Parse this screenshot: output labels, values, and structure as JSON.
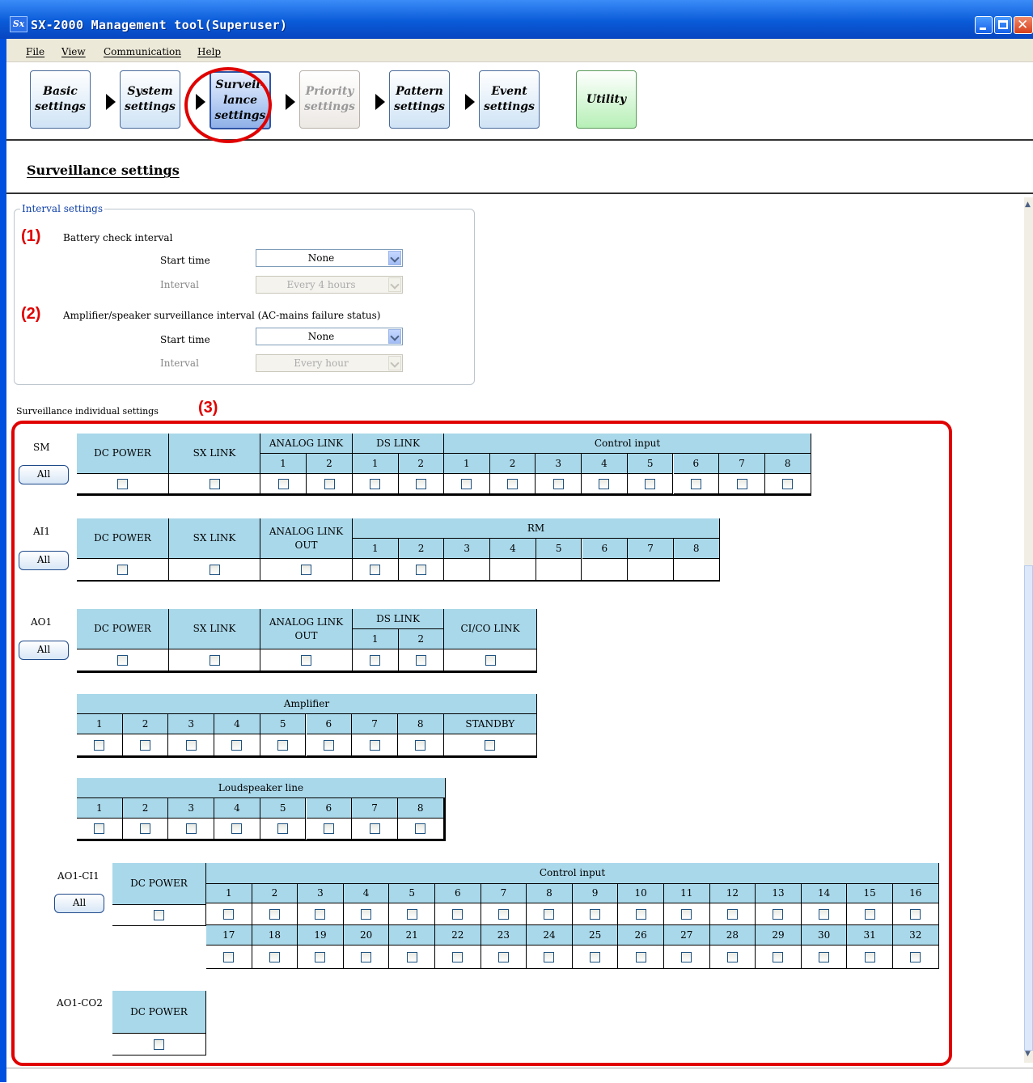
{
  "window": {
    "title": "SX-2000 Management tool(Superuser)",
    "app_icon": "Sx"
  },
  "menu": [
    "File",
    "View",
    "Communication",
    "Help"
  ],
  "nav": {
    "steps": [
      {
        "label": [
          "Basic",
          "settings"
        ],
        "state": "normal"
      },
      {
        "label": [
          "System",
          "settings"
        ],
        "state": "normal"
      },
      {
        "label": [
          "Surveil-",
          "lance",
          "settings"
        ],
        "state": "active"
      },
      {
        "label": [
          "Priority",
          "settings"
        ],
        "state": "disabled"
      },
      {
        "label": [
          "Pattern",
          "settings"
        ],
        "state": "normal"
      },
      {
        "label": [
          "Event",
          "settings"
        ],
        "state": "normal"
      },
      {
        "label": [
          "Utility"
        ],
        "state": "utility"
      }
    ]
  },
  "page": {
    "title": "Surveillance settings"
  },
  "interval": {
    "legend": "Interval settings",
    "battery": {
      "marker": "(1)",
      "title": "Battery check interval",
      "start_label": "Start time",
      "start_value": "None",
      "interval_label": "Interval",
      "interval_value": "Every 4 hours"
    },
    "amp": {
      "marker": "(2)",
      "title": "Amplifier/speaker surveillance interval (AC-mains failure status)",
      "start_label": "Start time",
      "start_value": "None",
      "interval_label": "Interval",
      "interval_value": "Every hour"
    }
  },
  "individual": {
    "title": "Surveillance individual settings",
    "marker": "(3)",
    "all_label": "All",
    "modules": {
      "sm": "SM",
      "ai1": "AI1",
      "ao1": "AO1",
      "ao1_ci1": "AO1-CI1",
      "ao1_co2": "AO1-CO2"
    },
    "headers": {
      "dc_power": "DC POWER",
      "sx_link": "SX LINK",
      "analog_link": "ANALOG LINK",
      "analog_link_out": [
        "ANALOG LINK",
        "OUT"
      ],
      "ds_link": "DS LINK",
      "control_input": "Control input",
      "rm": "RM",
      "cico_link": "CI/CO LINK",
      "amplifier": "Amplifier",
      "standby": "STANDBY",
      "loudspeaker_line": "Loudspeaker line"
    },
    "checkbox_state": "unchecked"
  }
}
